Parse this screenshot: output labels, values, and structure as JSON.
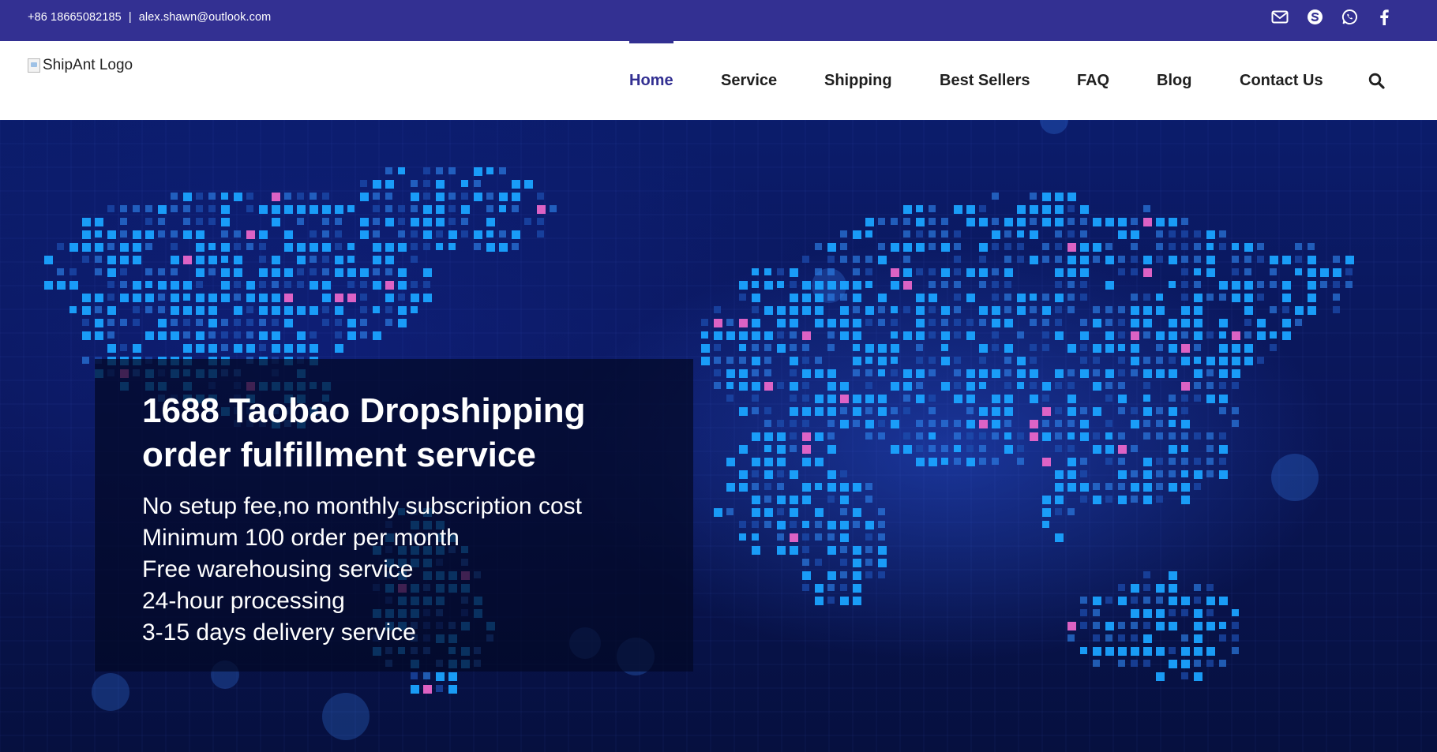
{
  "topbar": {
    "phone": "+86 18665082185",
    "separator": "|",
    "email": "alex.shawn@outlook.com",
    "social_icons": [
      "envelope-icon",
      "skype-icon",
      "whatsapp-icon",
      "facebook-icon"
    ],
    "background": "#333092"
  },
  "header": {
    "logo_alt": "ShipAnt Logo",
    "nav": [
      {
        "label": "Home",
        "active": true
      },
      {
        "label": "Service",
        "active": false
      },
      {
        "label": "Shipping",
        "active": false
      },
      {
        "label": "Best Sellers",
        "active": false
      },
      {
        "label": "FAQ",
        "active": false
      },
      {
        "label": "Blog",
        "active": false
      },
      {
        "label": "Contact Us",
        "active": false
      }
    ],
    "search_icon": "search-icon",
    "accent": "#333092"
  },
  "hero": {
    "title_line1": "1688 Taobao Dropshipping",
    "title_line2": "order fulfillment service",
    "bullets": [
      "No setup fee,no monthly subscription cost",
      "Minimum 100 order per month",
      "Free warehousing service",
      "24-hour processing",
      "3-15 days delivery service"
    ],
    "background": "world map made of blue and pink pixel squares",
    "colors": {
      "deep": "#06103f",
      "mid": "#0b1c6b",
      "pixel_blue": "#1aa3ff",
      "pixel_pink": "#e866c9"
    }
  }
}
